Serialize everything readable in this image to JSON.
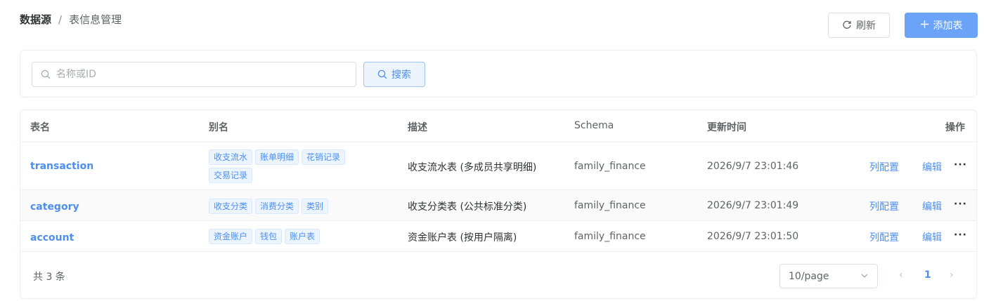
{
  "breadcrumb": {
    "root": "数据源",
    "separator": "/",
    "current": "表信息管理"
  },
  "toolbar": {
    "refresh_label": "刷新",
    "add_label": "添加表"
  },
  "search": {
    "placeholder": "名称或ID",
    "value": "",
    "button_label": "搜索"
  },
  "table": {
    "columns": [
      "表名",
      "别名",
      "描述",
      "Schema",
      "更新时间",
      "操作"
    ],
    "rows": [
      {
        "name": "transaction",
        "aliases": [
          "收支流水",
          "账单明细",
          "花销记录",
          "交易记录"
        ],
        "description": "收支流水表 (多成员共享明细)",
        "schema": "family_finance",
        "updated": "2026/9/7 23:01:46",
        "op_columns": "列配置",
        "op_edit": "编辑",
        "op_more": "···"
      },
      {
        "name": "category",
        "aliases": [
          "收支分类",
          "消费分类",
          "类别"
        ],
        "description": "收支分类表 (公共标准分类)",
        "schema": "family_finance",
        "updated": "2026/9/7 23:01:49",
        "op_columns": "列配置",
        "op_edit": "编辑",
        "op_more": "···"
      },
      {
        "name": "account",
        "aliases": [
          "资金账户",
          "钱包",
          "账户表"
        ],
        "description": "资金账户表 (按用户隔离)",
        "schema": "family_finance",
        "updated": "2026/9/7 23:01:50",
        "op_columns": "列配置",
        "op_edit": "编辑",
        "op_more": "···"
      }
    ]
  },
  "footer": {
    "total": "共 3 条",
    "page_size": "10/page",
    "prev": "‹",
    "current_page": "1",
    "next": "›"
  },
  "colors": {
    "accent": "#4d8ff0",
    "primary_button": "#6aa3f7",
    "tag_bg": "#ecf4fe"
  }
}
